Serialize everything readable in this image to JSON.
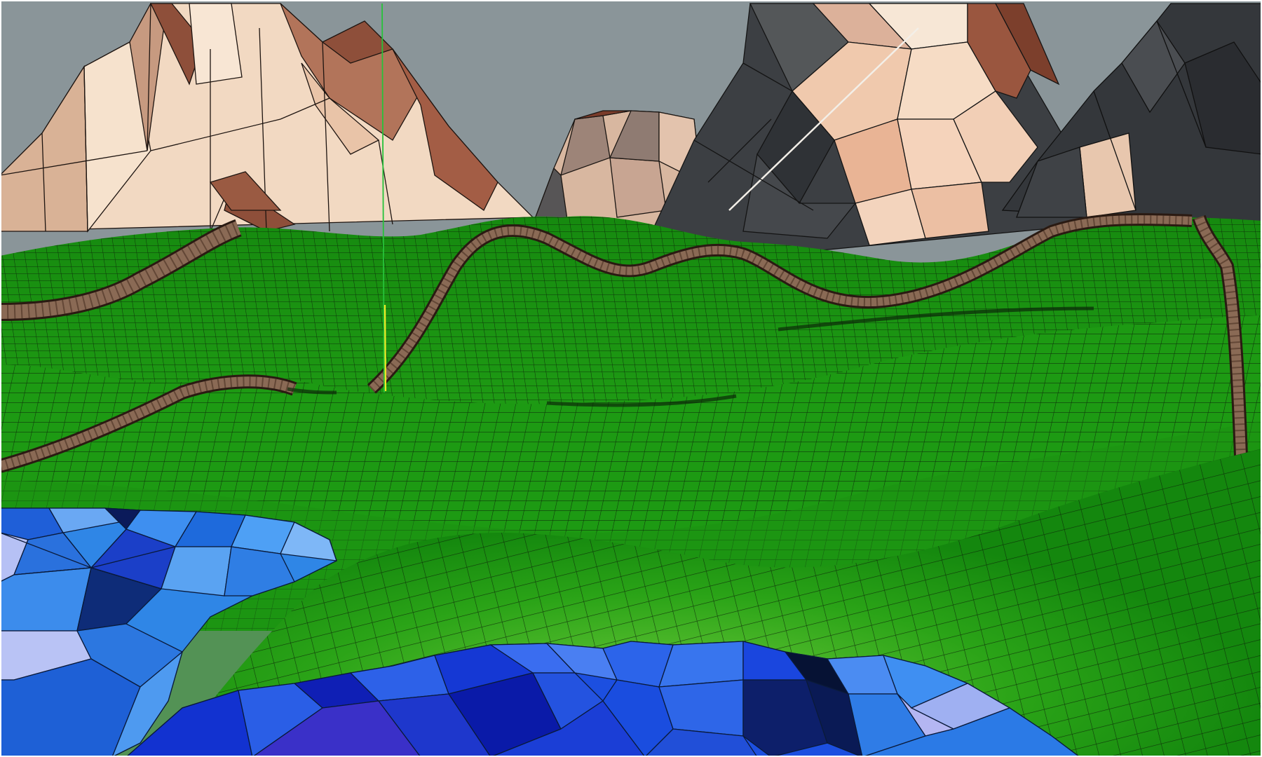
{
  "viewport": {
    "kind": "3d-terrain-wireframe-view",
    "colors": {
      "sky": "#8a9599",
      "terrain_green": "#1f9e12",
      "terrain_light": "#5fc431",
      "wire": "#0b2208",
      "road": "#8a6a55",
      "rock_light": "#f3dcc6",
      "rock_warm": "#e9b28f",
      "rock_brown": "#8e4f3a",
      "rock_dark": "#3b3f43",
      "water_blue": "#2f7fe0",
      "water_deep": "#1437d6",
      "water_pale": "#b7c4f5",
      "marker_green": "#27c23a",
      "marker_yellow": "#f2ea25"
    }
  }
}
